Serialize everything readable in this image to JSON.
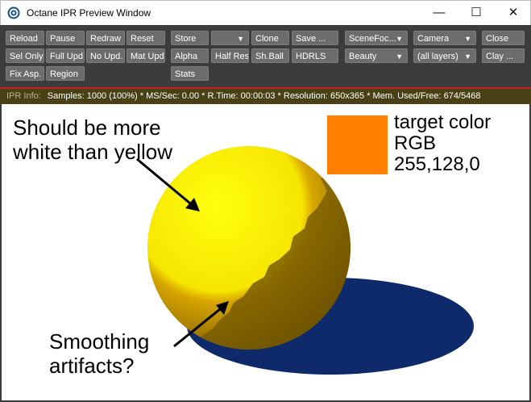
{
  "window": {
    "title": "Octane IPR Preview Window",
    "minimize_glyph": "—",
    "maximize_glyph": "☐",
    "close_glyph": "✕",
    "icon": "octane-logo-icon"
  },
  "toolbar": {
    "reload": "Reload",
    "pause": "Pause",
    "redraw": "Redraw",
    "reset": "Reset",
    "store": "Store",
    "clone": "Clone",
    "save": "Save ...",
    "scene_focus": "SceneFoc...",
    "camera": "Camera",
    "close": "Close",
    "sel_only": "Sel Only",
    "full_upd": "Full Upd.",
    "no_upd": "No Upd.",
    "mat_upd": "Mat Upd",
    "alpha": "Alpha",
    "half_res": "Half Res",
    "sh_ball": "Sh.Ball",
    "hdrls": "HDRLS",
    "beauty": "Beauty",
    "all_layers": "(all layers)",
    "clay": "Clay ...",
    "fix_asp": "Fix Asp.",
    "region": "Region",
    "stats": "Stats"
  },
  "info": {
    "label": "IPR Info:",
    "text": "Samples: 1000 (100%)  *  MS/Sec: 0.00  *  R.Time: 00:00:03  *  Resolution: 650x365  *  Mem. Used/Free: 674/5468"
  },
  "annotations": {
    "top_line1": "Should be more",
    "top_line2": "white than yellow",
    "bottom_line1": "Smoothing",
    "bottom_line2": "artifacts?",
    "target_line1": "target color",
    "target_line2": "RGB",
    "target_line3": "255,128,0"
  },
  "colors": {
    "target": "#ff8000",
    "sphere_bright": "#ffff00",
    "sphere_dark": "#8a6a00",
    "shadow": "#0e2a6a"
  }
}
